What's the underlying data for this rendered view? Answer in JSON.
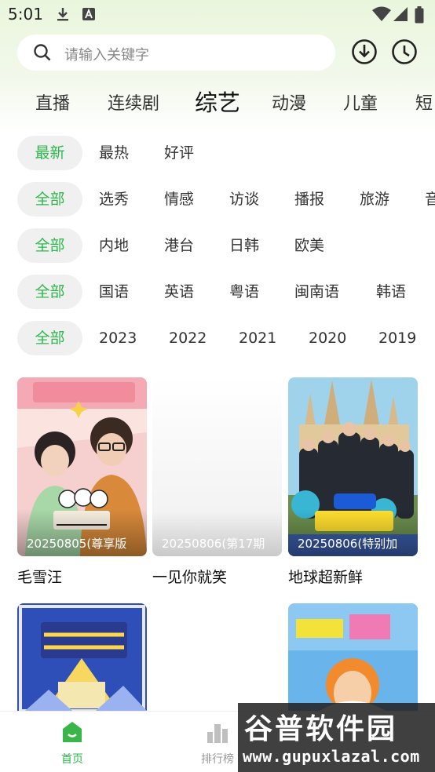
{
  "status_bar": {
    "time": "5:01"
  },
  "search": {
    "placeholder": "请输入关键字"
  },
  "tabs": [
    {
      "label": "直播"
    },
    {
      "label": "连续剧"
    },
    {
      "label": "综艺"
    },
    {
      "label": "动漫"
    },
    {
      "label": "儿童"
    },
    {
      "label": "短"
    }
  ],
  "active_tab": "综艺",
  "filters": {
    "sort": [
      "最新",
      "最热",
      "好评"
    ],
    "genre": [
      "全部",
      "选秀",
      "情感",
      "访谈",
      "播报",
      "旅游",
      "音"
    ],
    "region": [
      "全部",
      "内地",
      "港台",
      "日韩",
      "欧美"
    ],
    "language": [
      "全部",
      "国语",
      "英语",
      "粤语",
      "闽南语",
      "韩语"
    ],
    "year": [
      "全部",
      "2023",
      "2022",
      "2021",
      "2020",
      "2019"
    ]
  },
  "cards": [
    {
      "episode": "20250805(尊享版",
      "title": "毛雪汪"
    },
    {
      "episode": "20250806(第17期",
      "title": "一见你就笑"
    },
    {
      "episode": "20250806(特别加",
      "title": "地球超新鲜"
    },
    {
      "episode": "",
      "title": ""
    },
    {
      "episode": "",
      "title": ""
    }
  ],
  "bottom_nav": [
    {
      "label": "首页"
    },
    {
      "label": "排行榜"
    }
  ],
  "watermark": {
    "logo": "谷普软件园",
    "url": "www.gupuxlazal.com"
  },
  "colors": {
    "accent": "#2eb84c",
    "active_chip_bg": "#f0f0f0"
  }
}
